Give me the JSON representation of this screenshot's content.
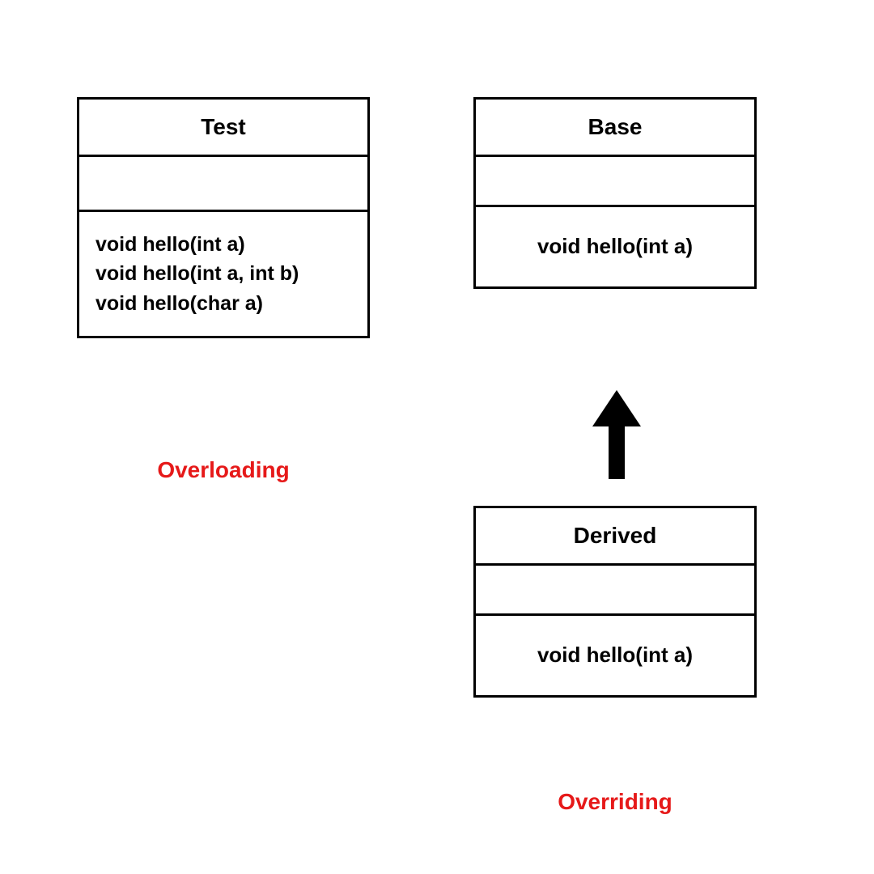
{
  "overloading": {
    "class_name": "Test",
    "methods": [
      "void hello(int a)",
      "void hello(int a, int b)",
      "void hello(char a)"
    ],
    "caption": "Overloading"
  },
  "overriding": {
    "base": {
      "class_name": "Base",
      "methods": [
        "void hello(int a)"
      ]
    },
    "derived": {
      "class_name": "Derived",
      "methods": [
        "void hello(int a)"
      ]
    },
    "caption": "Overriding"
  }
}
